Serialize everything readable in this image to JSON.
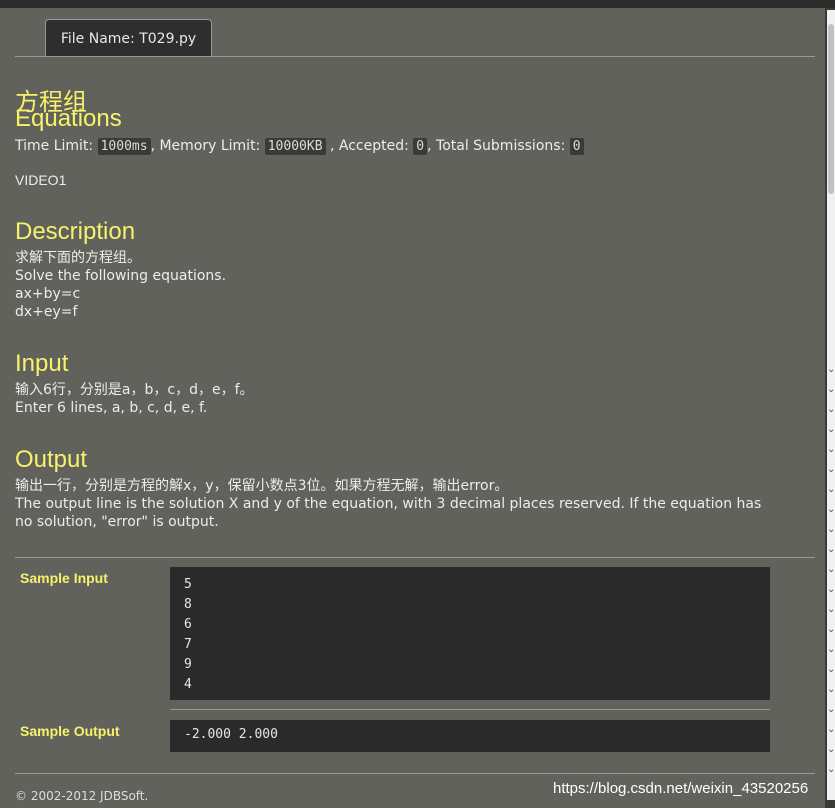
{
  "tab": {
    "file_label": "File Name:",
    "file_name": "T029.py"
  },
  "problem": {
    "title_cn": "方程组",
    "title_en": "Equations",
    "limits": {
      "time_label": "Time Limit:",
      "time_value": "1000ms",
      "memory_label": "Memory Limit:",
      "memory_value": "10000KB",
      "accepted_label": "Accepted:",
      "accepted_value": "0",
      "submissions_label": "Total Submissions:",
      "submissions_value": "0"
    },
    "source": "VIDEO1"
  },
  "description": {
    "heading": "Description",
    "lines": [
      "求解下面的方程组。",
      "Solve the following equations.",
      "ax+by=c",
      "dx+ey=f"
    ]
  },
  "input": {
    "heading": "Input",
    "lines": [
      "输入6行，分别是a，b，c，d，e，f。",
      "Enter 6 lines, a, b, c, d, e, f."
    ]
  },
  "output": {
    "heading": "Output",
    "line_cn": "输出一行，分别是方程的解x，y，保留小数点3位。如果方程无解，输出error。",
    "line_en": "The output line is the solution X and y of the equation, with 3 decimal places reserved. If the equation has no solution, \"error\" is output."
  },
  "sample_input": {
    "label": "Sample Input",
    "lines": [
      "5",
      "8",
      "6",
      "7",
      "9",
      "4"
    ]
  },
  "sample_output": {
    "label": "Sample Output",
    "value": "-2.000 2.000"
  },
  "footer": "© 2002-2012  JDBSoft.",
  "watermark": "https://blog.csdn.net/weixin_43520256",
  "icons": {
    "scroll_arrow": "chevron-down-icon"
  }
}
